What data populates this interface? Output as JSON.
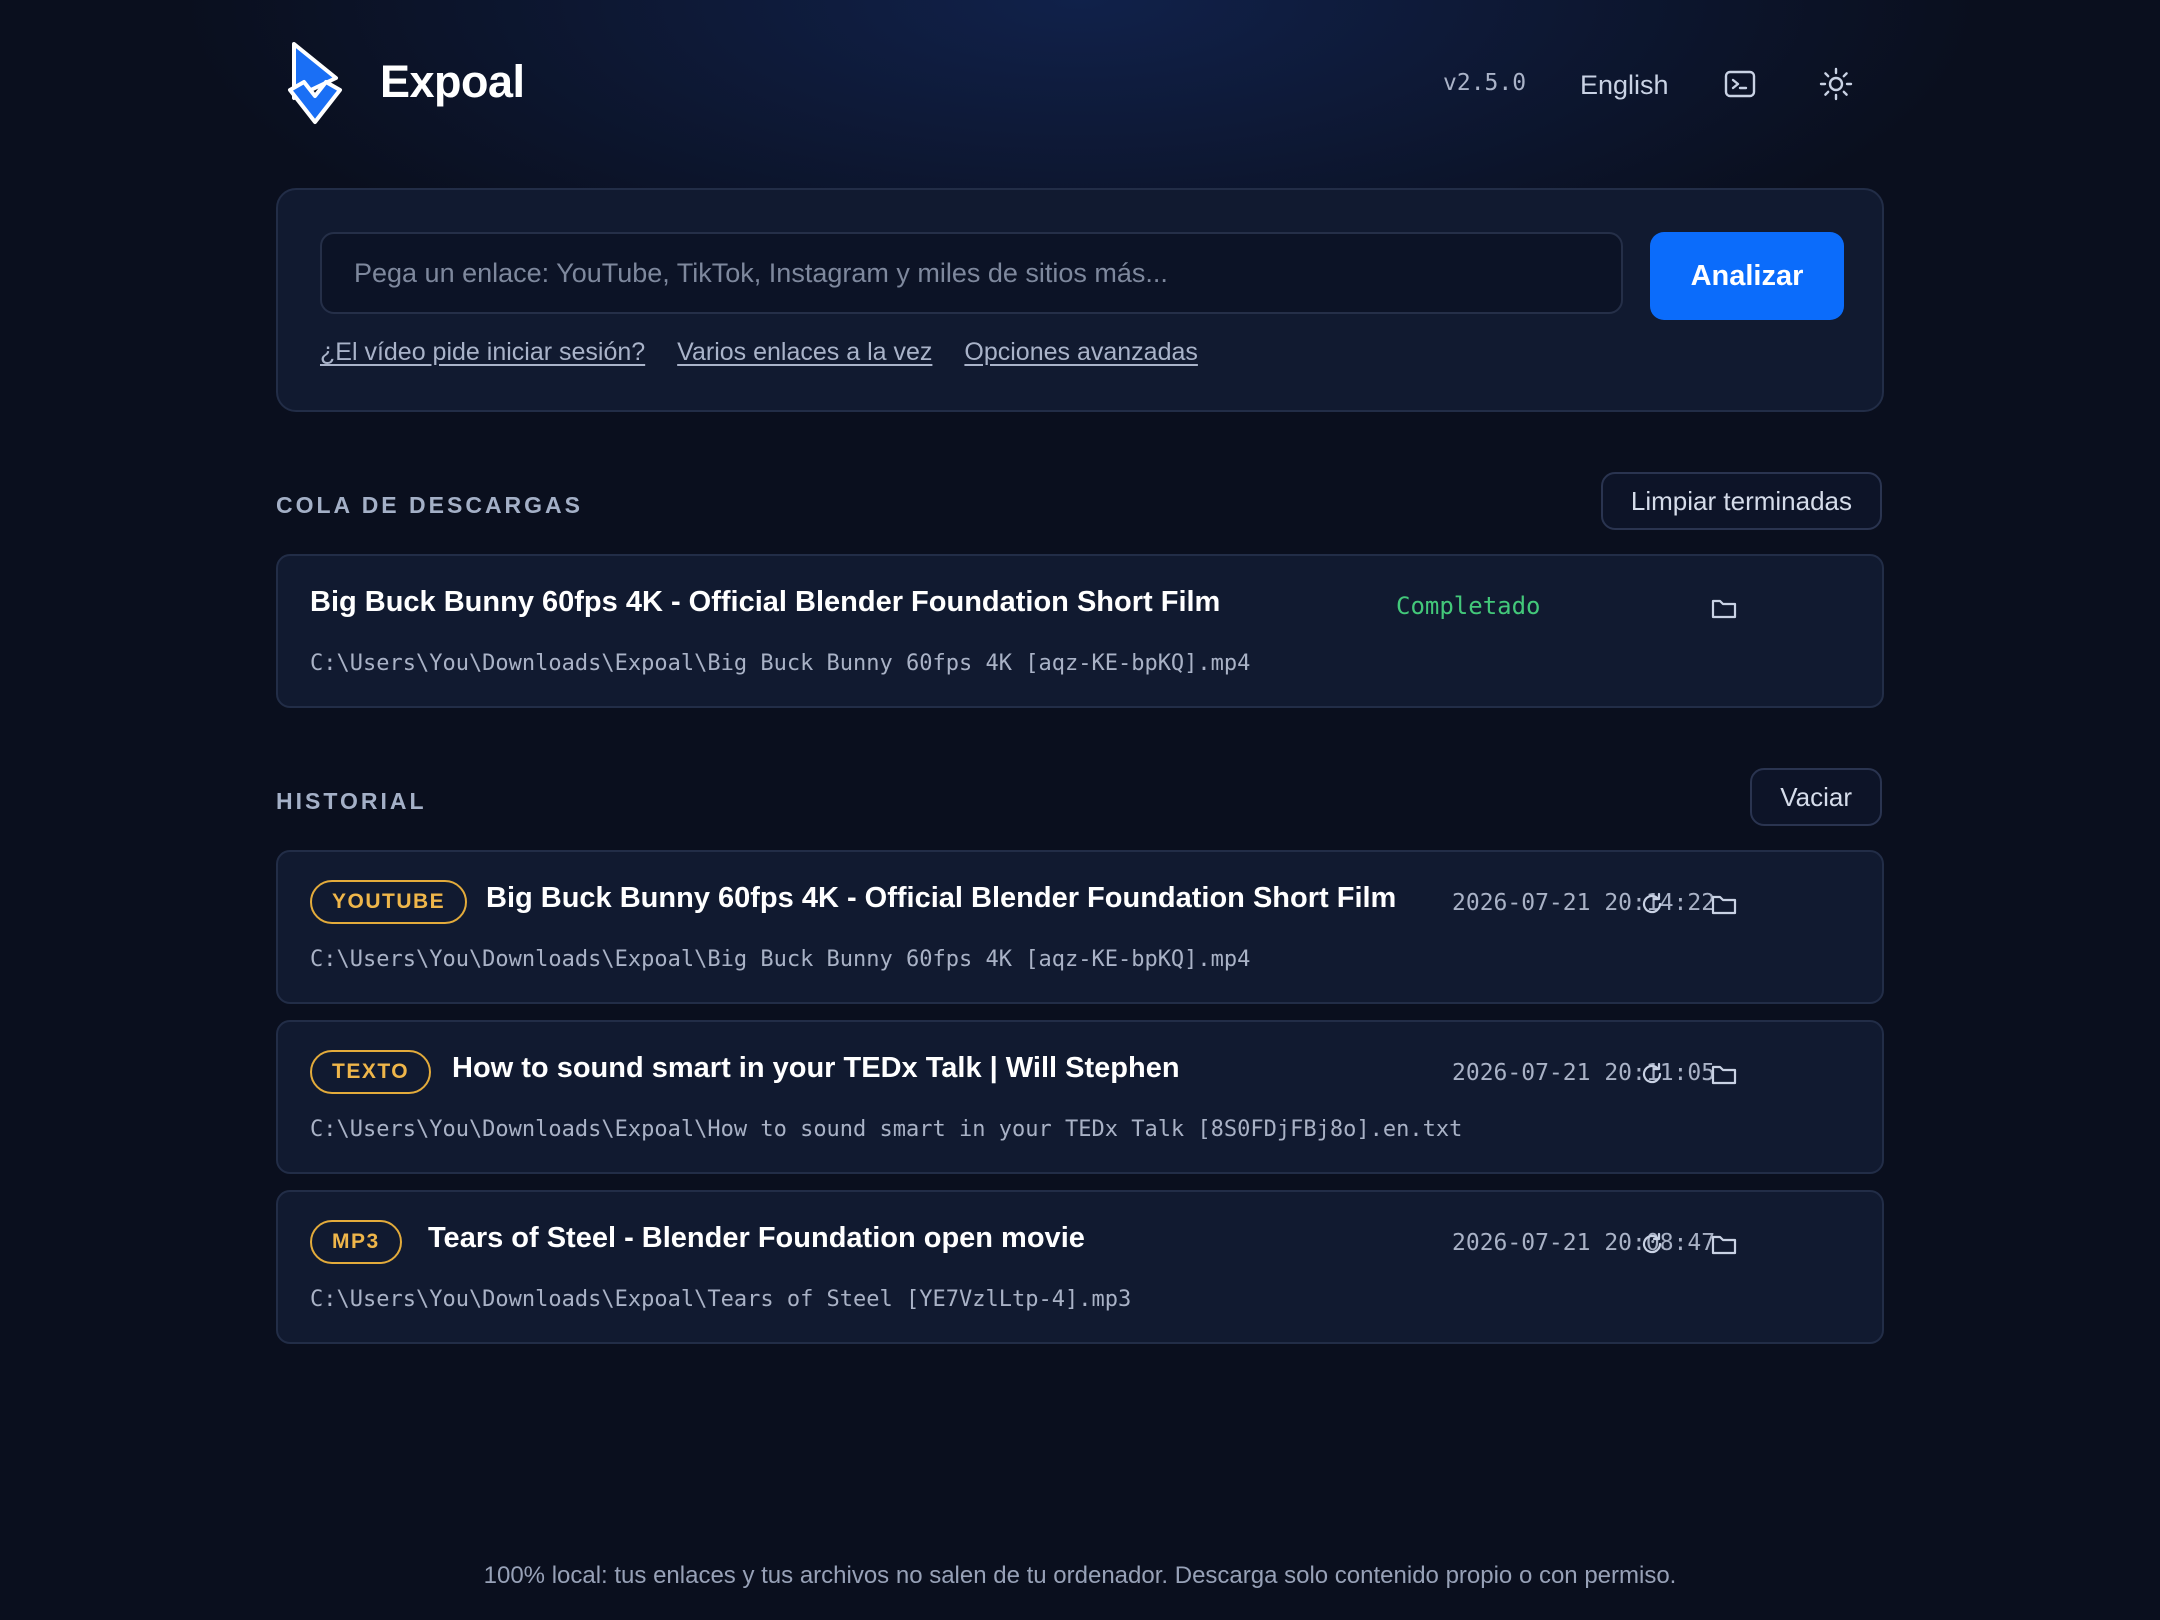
{
  "app": {
    "name": "Expoal",
    "version": "v2.5.0",
    "language": "English",
    "terminal_icon": "terminal-icon",
    "theme_icon": "sun-icon",
    "accent": "#0b6cfb"
  },
  "search": {
    "placeholder": "Pega un enlace: YouTube, TikTok, Instagram y miles de sitios más...",
    "value": "",
    "button": "Analizar",
    "links": [
      "¿El vídeo pide iniciar sesión?",
      "Varios enlaces a la vez",
      "Opciones avanzadas"
    ]
  },
  "queue": {
    "title": "COLA DE DESCARGAS",
    "clear_button": "Limpiar terminadas",
    "items": [
      {
        "title": "Big Buck Bunny 60fps 4K - Official Blender Foundation Short Film",
        "status": "Completado",
        "status_color": "#43c87a",
        "path": "C:\\Users\\You\\Downloads\\Expoal\\Big Buck Bunny 60fps 4K [aqz-KE-bpKQ].mp4",
        "icon": "folder-icon"
      }
    ]
  },
  "history": {
    "title": "HISTORIAL",
    "clear_button": "Vaciar",
    "badge_color": "#efb64a",
    "items": [
      {
        "badge": "YOUTUBE",
        "title": "Big Buck Bunny 60fps 4K - Official Blender Foundation Short Film",
        "date": "2026-07-21 20:14:22",
        "path": "C:\\Users\\You\\Downloads\\Expoal\\Big Buck Bunny 60fps 4K [aqz-KE-bpKQ].mp4"
      },
      {
        "badge": "TEXTO",
        "title": "How to sound smart in your TEDx Talk | Will Stephen",
        "date": "2026-07-21 20:11:05",
        "path": "C:\\Users\\You\\Downloads\\Expoal\\How to sound smart in your TEDx Talk [8S0FDjFBj8o].en.txt"
      },
      {
        "badge": "MP3",
        "title": "Tears of Steel - Blender Foundation open movie",
        "date": "2026-07-21 20:08:47",
        "path": "C:\\Users\\You\\Downloads\\Expoal\\Tears of Steel [YE7VzlLtp-4].mp3"
      }
    ]
  },
  "footer": "100% local: tus enlaces y tus archivos no salen de tu ordenador. Descarga solo contenido propio o con permiso."
}
